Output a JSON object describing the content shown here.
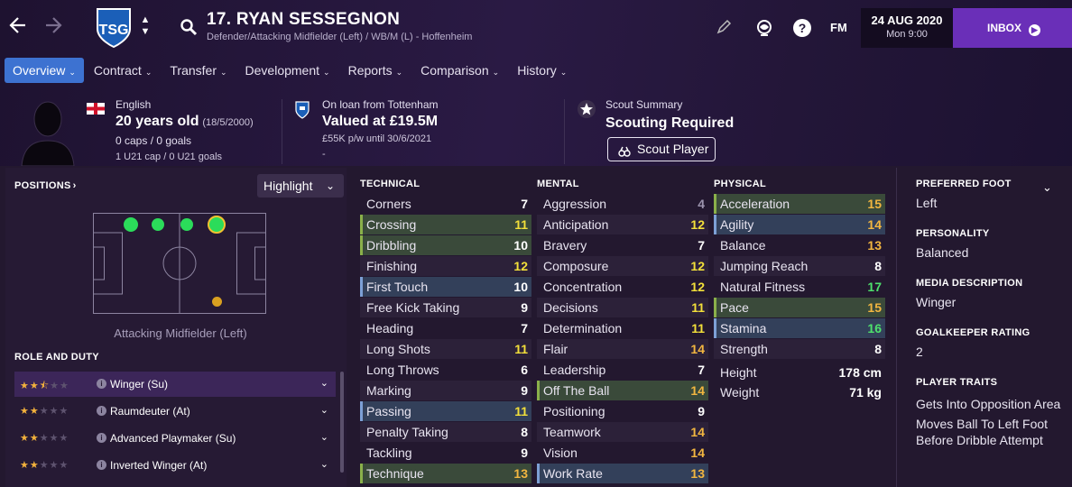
{
  "header": {
    "player_name": "17. RYAN SESSEGNON",
    "player_subtitle": "Defender/Attacking Midfielder (Left) / WB/M (L) - Hoffenheim",
    "date": "24 AUG 2020",
    "time": "Mon 9:00",
    "inbox_label": "INBOX",
    "fm_label": "FM"
  },
  "tabs": [
    {
      "label": "Overview"
    },
    {
      "label": "Contract"
    },
    {
      "label": "Transfer"
    },
    {
      "label": "Development"
    },
    {
      "label": "Reports"
    },
    {
      "label": "Comparison"
    },
    {
      "label": "History"
    }
  ],
  "profile": {
    "nationality": "English",
    "age": "20 years old",
    "dob": "(18/5/2000)",
    "caps": "0 caps / 0 goals",
    "u21": "1 U21 cap / 0 U21 goals"
  },
  "loan": {
    "status": "On loan from Tottenham",
    "value": "Valued at £19.5M",
    "wage": "£55K p/w until 30/6/2021",
    "extra": "-"
  },
  "scout": {
    "title": "Scout Summary",
    "status": "Scouting Required",
    "button": "Scout Player"
  },
  "positions": {
    "title": "POSITIONS",
    "highlight_label": "Highlight",
    "position_label": "Attacking Midfielder (Left)"
  },
  "role_and_duty": {
    "title": "ROLE AND DUTY",
    "roles": [
      {
        "name": "Winger (Su)",
        "stars": 2.5
      },
      {
        "name": "Raumdeuter (At)",
        "stars": 2
      },
      {
        "name": "Advanced Playmaker (Su)",
        "stars": 2
      },
      {
        "name": "Inverted Winger (At)",
        "stars": 2
      }
    ]
  },
  "technical": {
    "title": "TECHNICAL",
    "attrs": [
      {
        "name": "Corners",
        "value": "7"
      },
      {
        "name": "Crossing",
        "value": "11"
      },
      {
        "name": "Dribbling",
        "value": "10"
      },
      {
        "name": "Finishing",
        "value": "12"
      },
      {
        "name": "First Touch",
        "value": "10"
      },
      {
        "name": "Free Kick Taking",
        "value": "9"
      },
      {
        "name": "Heading",
        "value": "7"
      },
      {
        "name": "Long Shots",
        "value": "11"
      },
      {
        "name": "Long Throws",
        "value": "6"
      },
      {
        "name": "Marking",
        "value": "9"
      },
      {
        "name": "Passing",
        "value": "11"
      },
      {
        "name": "Penalty Taking",
        "value": "8"
      },
      {
        "name": "Tackling",
        "value": "9"
      },
      {
        "name": "Technique",
        "value": "13"
      }
    ]
  },
  "mental": {
    "title": "MENTAL",
    "attrs": [
      {
        "name": "Aggression",
        "value": "4"
      },
      {
        "name": "Anticipation",
        "value": "12"
      },
      {
        "name": "Bravery",
        "value": "7"
      },
      {
        "name": "Composure",
        "value": "12"
      },
      {
        "name": "Concentration",
        "value": "12"
      },
      {
        "name": "Decisions",
        "value": "11"
      },
      {
        "name": "Determination",
        "value": "11"
      },
      {
        "name": "Flair",
        "value": "14"
      },
      {
        "name": "Leadership",
        "value": "7"
      },
      {
        "name": "Off The Ball",
        "value": "14"
      },
      {
        "name": "Positioning",
        "value": "9"
      },
      {
        "name": "Teamwork",
        "value": "14"
      },
      {
        "name": "Vision",
        "value": "14"
      },
      {
        "name": "Work Rate",
        "value": "13"
      }
    ]
  },
  "physical": {
    "title": "PHYSICAL",
    "attrs": [
      {
        "name": "Acceleration",
        "value": "15"
      },
      {
        "name": "Agility",
        "value": "14"
      },
      {
        "name": "Balance",
        "value": "13"
      },
      {
        "name": "Jumping Reach",
        "value": "8"
      },
      {
        "name": "Natural Fitness",
        "value": "17"
      },
      {
        "name": "Pace",
        "value": "15"
      },
      {
        "name": "Stamina",
        "value": "16"
      },
      {
        "name": "Strength",
        "value": "8"
      }
    ],
    "height_label": "Height",
    "height": "178 cm",
    "weight_label": "Weight",
    "weight": "71 kg"
  },
  "side_info": {
    "preferred_foot_title": "PREFERRED FOOT",
    "preferred_foot": "Left",
    "personality_title": "PERSONALITY",
    "personality": "Balanced",
    "media_title": "MEDIA DESCRIPTION",
    "media": "Winger",
    "gk_title": "GOALKEEPER RATING",
    "gk": "2",
    "traits_title": "PLAYER TRAITS",
    "trait_1": "Gets Into Opposition Area",
    "trait_2_line1": "Moves Ball To Left Foot",
    "trait_2_line2": "Before Dribble Attempt"
  },
  "colors": {
    "accent_blue": "#3d72d1",
    "inbox_purple": "#6a2fb8",
    "value_yellow": "#f3e03a",
    "value_orange": "#f2b640",
    "value_green": "#4ee06c"
  }
}
